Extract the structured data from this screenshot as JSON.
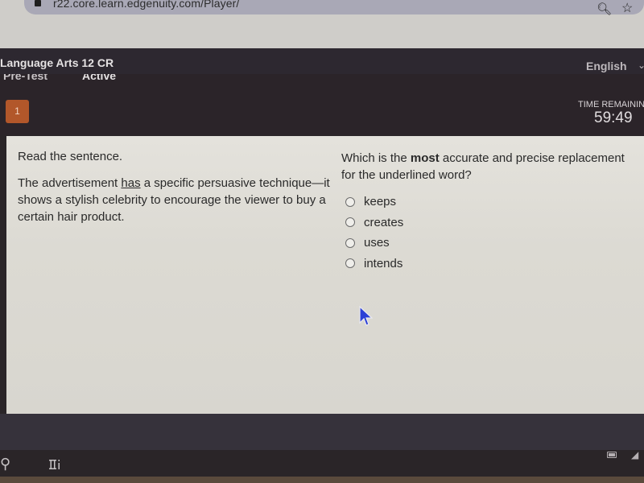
{
  "browser": {
    "url": "r22.core.learn.edgenuity.com/Player/",
    "icons": {
      "lock": "lock-icon",
      "zoom": "zoom-in-icon",
      "bookmark": "star-icon"
    }
  },
  "header": {
    "course_title": "Language Arts 12 CR",
    "language": "English",
    "tabs": [
      {
        "label": "Pre-Test"
      },
      {
        "label": "Active"
      }
    ],
    "question_number": "1",
    "time_remaining_label": "TIME REMAINING",
    "time_remaining_value": "59:49"
  },
  "prompt": {
    "instruction": "Read the sentence.",
    "sentence_before": "The advertisement ",
    "underlined_word": "has",
    "sentence_after": " a specific persuasive technique—it shows a stylish celebrity to encourage the viewer to buy a certain hair product."
  },
  "question": {
    "text_before": "Which is the ",
    "text_bold": "most",
    "text_after": " accurate and precise replacement for the underlined word?",
    "options": [
      {
        "label": "keeps",
        "selected": false
      },
      {
        "label": "creates",
        "selected": false
      },
      {
        "label": "uses",
        "selected": false
      },
      {
        "label": "intends",
        "selected": false
      }
    ]
  },
  "taskbar": {
    "icons": [
      "search-icon",
      "task-view-icon",
      "battery-icon",
      "wifi-icon"
    ]
  },
  "colors": {
    "header_bg": "#2b2429",
    "question_number_bg": "#b2572a",
    "cursor": "#2b3fd6",
    "card_bg": "#e2e0da"
  }
}
